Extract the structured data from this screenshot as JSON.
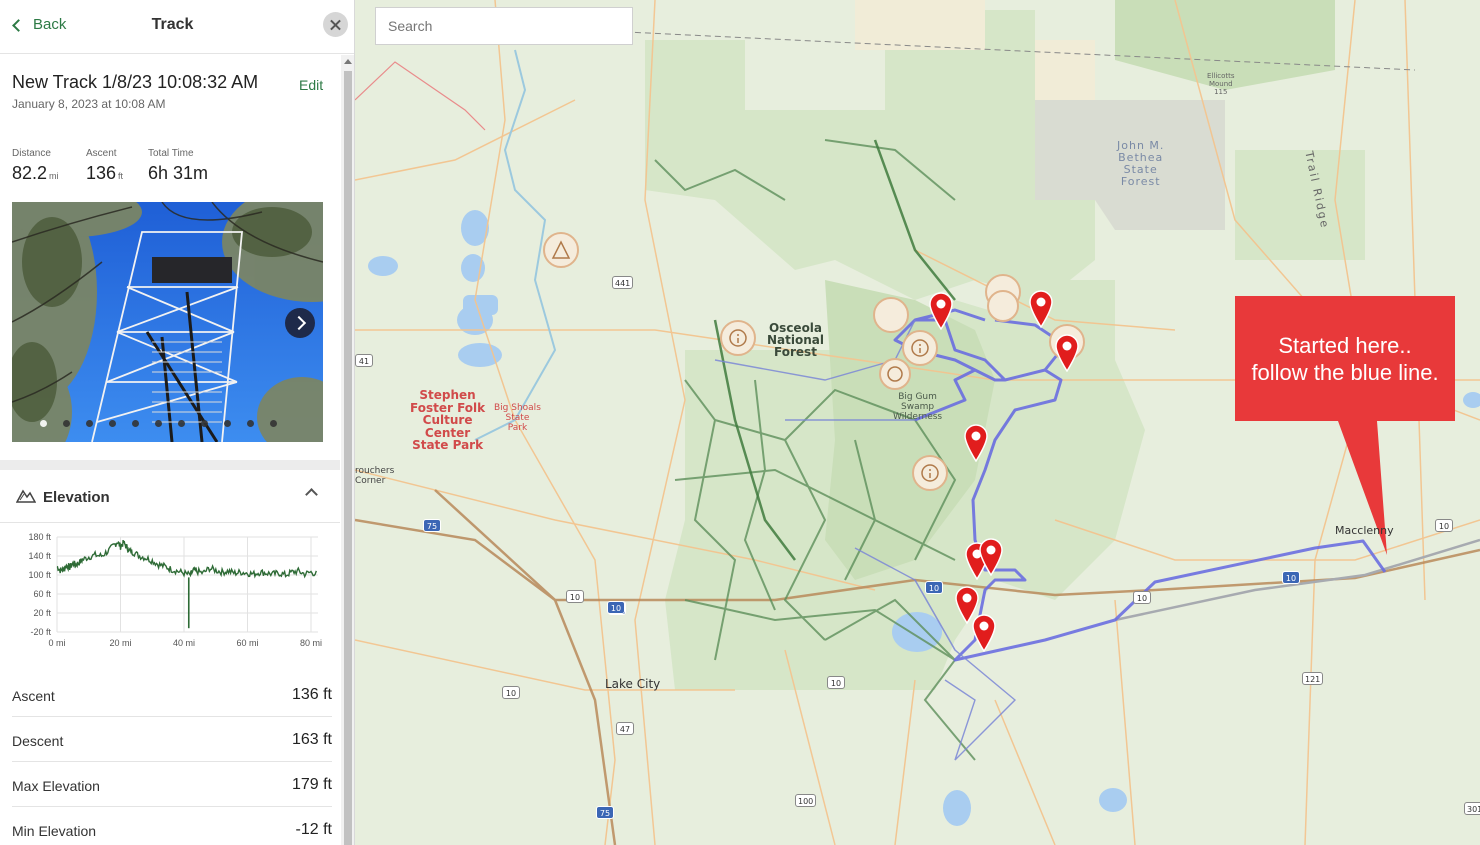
{
  "header": {
    "back_label": "Back",
    "title": "Track"
  },
  "track": {
    "name": "New Track 1/8/23 10:08:32 AM",
    "edit_label": "Edit",
    "date": "January 8, 2023 at 10:08 AM"
  },
  "stats": [
    {
      "label": "Distance",
      "value": "82.2",
      "unit": "mi"
    },
    {
      "label": "Ascent",
      "value": "136",
      "unit": "ft"
    },
    {
      "label": "Total Time",
      "value": "6h 31m",
      "unit": ""
    }
  ],
  "photo": {
    "total": 11,
    "active_index": 0
  },
  "elevation": {
    "title": "Elevation",
    "y_ticks": [
      "180 ft",
      "140 ft",
      "100 ft",
      "60 ft",
      "20 ft",
      "-20 ft"
    ],
    "x_ticks": [
      "0 mi",
      "20 mi",
      "40 mi",
      "60 mi",
      "80 mi"
    ],
    "line_color": "#2e6b36",
    "rows": [
      {
        "label": "Ascent",
        "value": "136 ft"
      },
      {
        "label": "Descent",
        "value": "163 ft"
      },
      {
        "label": "Max Elevation",
        "value": "179 ft"
      },
      {
        "label": "Min Elevation",
        "value": "-12 ft"
      }
    ]
  },
  "map": {
    "search_placeholder": "Search",
    "callout": "Started here..\nfollow the blue line.",
    "callout_color": "#e8393a",
    "route_color": "#6a6ee0",
    "marker_color": "#e11d1d",
    "labels": {
      "osceola": "Osceola\nNational\nForest",
      "big_gum": "Big Gum\nSwamp\nWilderness",
      "stephen_foster": "Stephen\nFoster Folk\nCulture\nCenter\nState Park",
      "big_shoals": "Big Shoals\nState\nPark",
      "john_bethea": "John M.\nBethea\nState\nForest",
      "ellicotts": "Ellicotts\nMound\n115",
      "trail_ridge": "Trail Ridge",
      "macclenny": "Macclenny",
      "lake_city": "Lake City",
      "crouchers_corner": "rouchers\nCorner"
    },
    "shields": [
      "441",
      "41",
      "75",
      "10",
      "10",
      "41",
      "10",
      "10",
      "10",
      "10",
      "10",
      "121",
      "47",
      "75",
      "100",
      "301",
      "10",
      "10"
    ]
  }
}
